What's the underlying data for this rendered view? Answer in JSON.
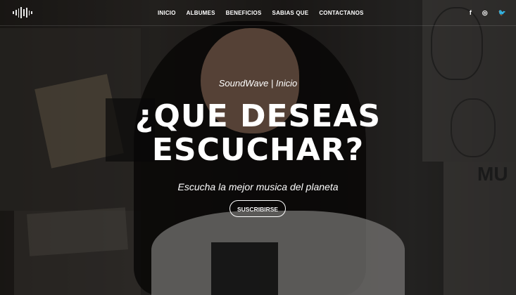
{
  "nav": {
    "logo_icon": "soundwave-logo-icon",
    "items": [
      "INICIO",
      "ALBUMES",
      "BENEFICIOS",
      "SABIAS QUE",
      "CONTACTANOS"
    ],
    "social": [
      {
        "icon": "facebook-icon",
        "glyph": "f"
      },
      {
        "icon": "instagram-icon",
        "glyph": "◎"
      },
      {
        "icon": "twitter-icon",
        "glyph": "🐦"
      }
    ]
  },
  "hero": {
    "kicker": "SoundWave | Inicio",
    "headline_line1": "¿QUE DESEAS",
    "headline_line2": "ESCUCHAR?",
    "subtitle": "Escucha la mejor musica del planeta",
    "cta_label": "SUSCRIBIRSE"
  },
  "colors": {
    "text": "#ffffff",
    "overlay": "rgba(0,0,0,0.42)"
  }
}
